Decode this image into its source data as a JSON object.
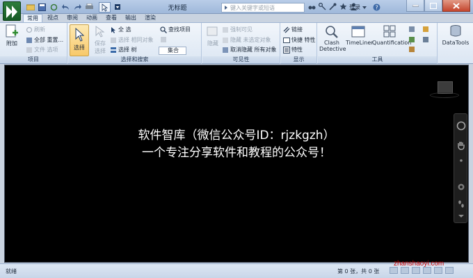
{
  "window": {
    "title": "无标题",
    "search_placeholder": "键入关键字或短语",
    "login_label": "登录"
  },
  "tabs": [
    {
      "label": "常用",
      "active": true
    },
    {
      "label": "视点"
    },
    {
      "label": "审阅"
    },
    {
      "label": "动画"
    },
    {
      "label": "查看"
    },
    {
      "label": "输出"
    },
    {
      "label": "渲染"
    }
  ],
  "ribbon": {
    "project": {
      "label": "项目",
      "append": "附加",
      "refresh": "刷新",
      "reset_all": "全部 重置...",
      "file_options": "文件 选项"
    },
    "select_search": {
      "label": "选择和搜索",
      "select": "选择",
      "save_selection": "保存 选择",
      "select_all": "全 选",
      "select_same": "选择 相同对象",
      "selection_tree": "选择 树",
      "find_items": "查找项目",
      "dropdown_value": "集合"
    },
    "visibility": {
      "label": "可见性",
      "hide": "隐藏",
      "require": "强制可见",
      "hide_unselected": "隐藏 未选定对象",
      "unhide_all": "取消隐藏 所有对象"
    },
    "display": {
      "label": "显示",
      "links": "链接",
      "quick_props": "快捷 特性",
      "properties": "特性"
    },
    "tools": {
      "label": "工具",
      "clash": "Clash Detective",
      "timeliner": "TimeLiner",
      "quantification": "Quantification",
      "datatools": "DataTools"
    }
  },
  "viewport": {
    "line1": "软件智库（微信公众号ID：rjzkgzh）",
    "line2": "一个专注分享软件和教程的公众号！"
  },
  "status": {
    "text": "就绪",
    "sheet_info": "第 0 张，共 0 张",
    "site": "zhanshaoyi.com"
  },
  "colors": {
    "accent": "#2d7d3c",
    "viewport_bg": "#000000"
  }
}
